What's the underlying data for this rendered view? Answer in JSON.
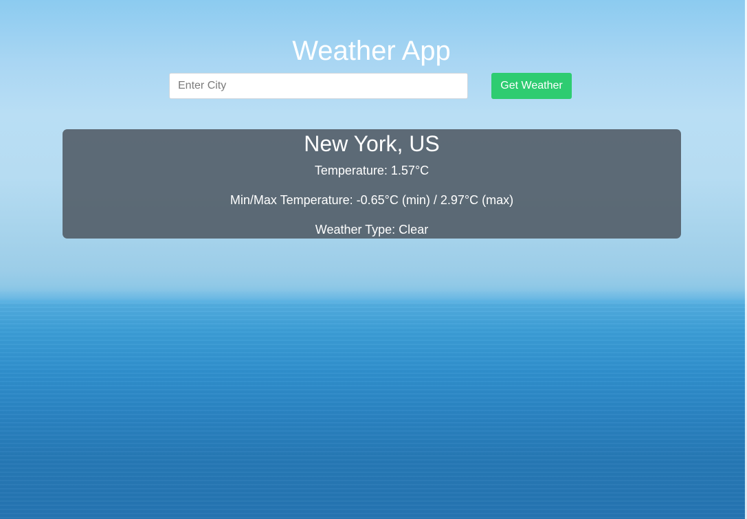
{
  "app": {
    "title": "Weather App"
  },
  "search": {
    "placeholder": "Enter City",
    "value": "",
    "button_label": "Get Weather"
  },
  "result": {
    "location": "New York, US",
    "temperature": "Temperature: 1.57°C",
    "min_max": "Min/Max Temperature: -0.65°C (min) / 2.97°C (max)",
    "weather_type": "Weather Type: Clear"
  },
  "colors": {
    "button": "#2ecc71",
    "card": "#505a64",
    "text": "#ffffff"
  }
}
